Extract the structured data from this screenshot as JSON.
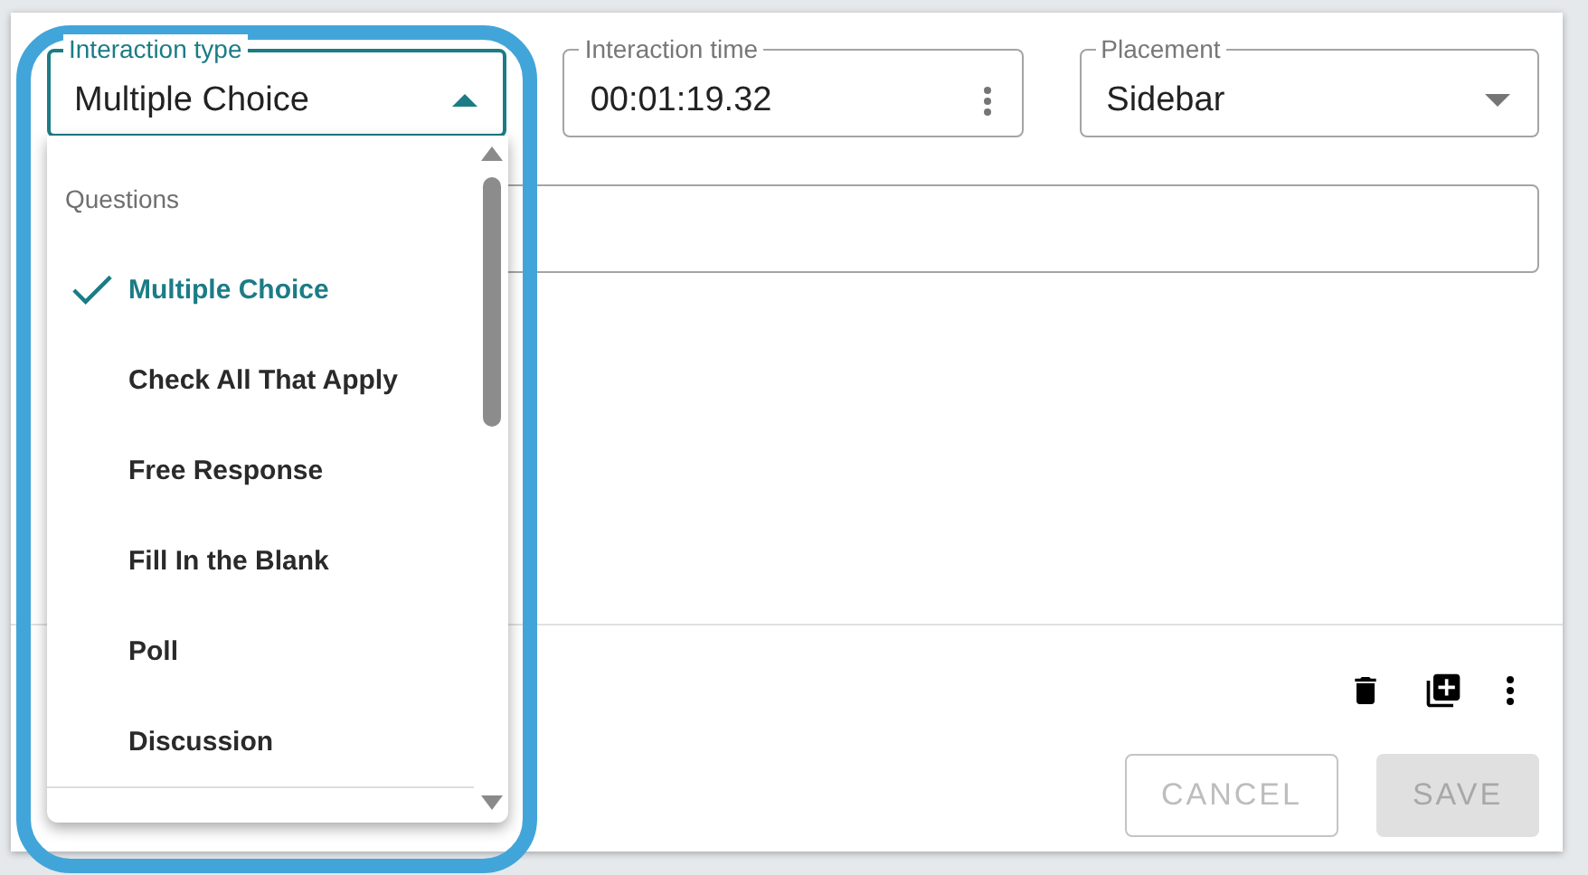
{
  "fields": [
    {
      "kind": "select",
      "label": "Interaction type",
      "value": "Multiple Choice",
      "expanded": true
    },
    {
      "kind": "time",
      "label": "Interaction time",
      "value": "00:01:19.32"
    },
    {
      "kind": "select",
      "label": "Placement",
      "value": "Sidebar",
      "expanded": false
    }
  ],
  "dropdown": {
    "group": "Questions",
    "options": [
      {
        "label": "Multiple Choice",
        "selected": true
      },
      {
        "label": "Check All That Apply",
        "selected": false
      },
      {
        "label": "Free Response",
        "selected": false
      },
      {
        "label": "Fill In the Blank",
        "selected": false
      },
      {
        "label": "Poll",
        "selected": false
      },
      {
        "label": "Discussion",
        "selected": false
      }
    ]
  },
  "buttons": [
    {
      "label": "CANCEL",
      "kind": "outlined",
      "disabled": true
    },
    {
      "label": "SAVE",
      "kind": "contained",
      "disabled": true
    }
  ]
}
